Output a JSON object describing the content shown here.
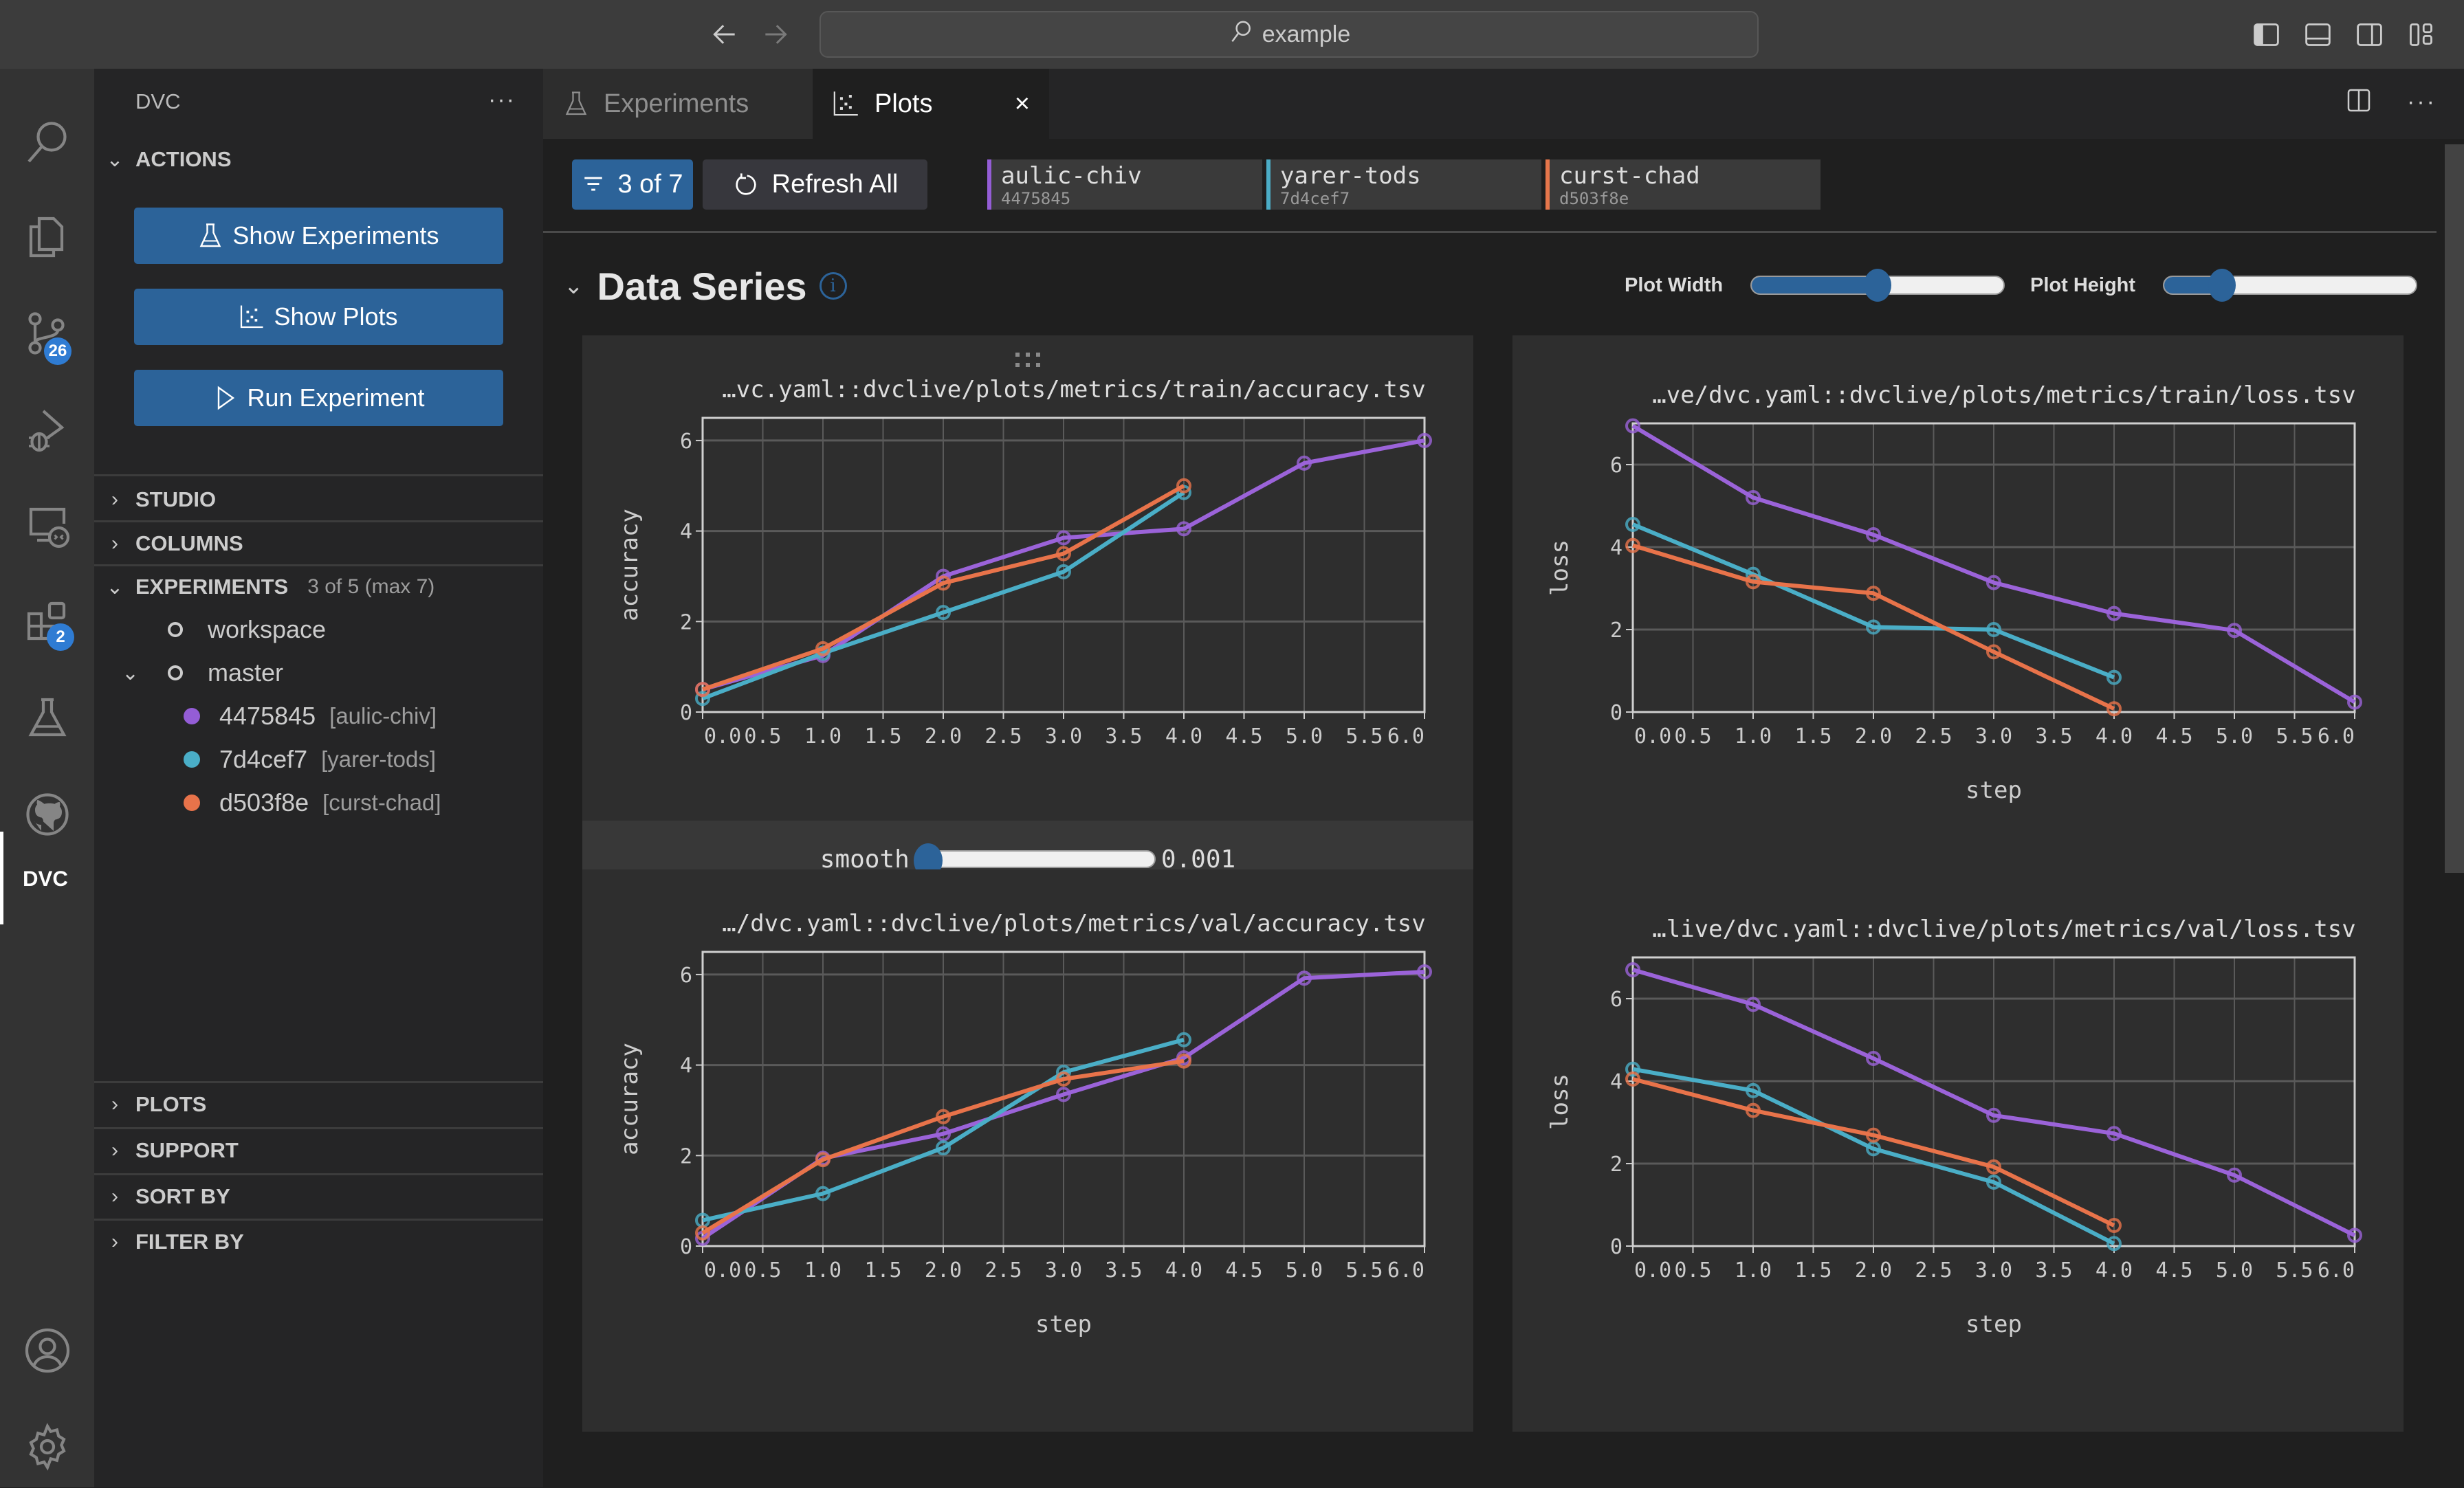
{
  "titlebar": {
    "search_text": "example",
    "back_icon": "arrow-left-icon",
    "forward_icon": "arrow-right-icon",
    "layout_icons": [
      "toggle-primary-sidebar-icon",
      "toggle-panel-icon",
      "toggle-secondary-sidebar-icon",
      "customize-layout-icon"
    ]
  },
  "activity_bar": {
    "items": [
      {
        "name": "search",
        "icon": "search-icon"
      },
      {
        "name": "explorer",
        "icon": "files-icon"
      },
      {
        "name": "source-control",
        "icon": "source-control-icon",
        "badge": "26"
      },
      {
        "name": "run-debug",
        "icon": "debug-icon"
      },
      {
        "name": "remote-explorer",
        "icon": "remote-explorer-icon"
      },
      {
        "name": "extensions",
        "icon": "extensions-icon",
        "badge": "2"
      },
      {
        "name": "testing",
        "icon": "flask-icon"
      },
      {
        "name": "github",
        "icon": "github-icon"
      },
      {
        "name": "dvc",
        "icon": "dvc-logo-icon",
        "active": true,
        "label": "DVC"
      }
    ],
    "bottom": [
      {
        "name": "accounts",
        "icon": "account-icon"
      },
      {
        "name": "manage",
        "icon": "gear-icon"
      }
    ]
  },
  "sidebar": {
    "title": "DVC",
    "more": "···",
    "actions": {
      "header": "ACTIONS",
      "buttons": [
        {
          "label": "Show Experiments",
          "icon": "flask-icon"
        },
        {
          "label": "Show Plots",
          "icon": "scatter-plot-icon"
        },
        {
          "label": "Run Experiment",
          "icon": "play-icon"
        }
      ]
    },
    "sections": {
      "studio": "STUDIO",
      "columns": "COLUMNS",
      "experiments": "EXPERIMENTS",
      "experiments_count": "3 of 5 (max 7)",
      "plots": "PLOTS",
      "support": "SUPPORT",
      "sort_by": "SORT BY",
      "filter_by": "FILTER BY"
    },
    "experiments_tree": {
      "workspace": "workspace",
      "master": "master",
      "experiments": [
        {
          "id": "4475845",
          "name": "[aulic-chiv]",
          "color": "#945dd6"
        },
        {
          "id": "7d4cef7",
          "name": "[yarer-tods]",
          "color": "#13adc7"
        },
        {
          "id": "d503f8e",
          "name": "[curst-chad]",
          "color": "#f46837"
        }
      ]
    }
  },
  "tabs": [
    {
      "label": "Experiments",
      "icon": "flask-icon",
      "active": false
    },
    {
      "label": "Plots",
      "icon": "scatter-plot-icon",
      "active": true,
      "close": "×"
    }
  ],
  "toolbar": {
    "filter_label": "3 of 7",
    "refresh_label": "Refresh All",
    "experiments": [
      {
        "name": "aulic-chiv",
        "rev": "4475845",
        "color": "#945dd6"
      },
      {
        "name": "yarer-tods",
        "rev": "7d4cef7",
        "color": "#4bacc6"
      },
      {
        "name": "curst-chad",
        "rev": "d503f8e",
        "color": "#e6764b"
      }
    ]
  },
  "section": {
    "title": "Data Series",
    "info": "i",
    "plot_width_label": "Plot Width",
    "plot_height_label": "Plot Height",
    "plot_width_value": 0.5,
    "plot_height_value": 0.23
  },
  "smooth": {
    "label": "smooth",
    "value": "0.001",
    "fraction": 0.0
  },
  "series_colors": {
    "aulic-chiv": "#9b63d9",
    "yarer-tods": "#4aaec7",
    "curst-chad": "#e8734a"
  },
  "chart_data": [
    {
      "type": "line",
      "title": "…vc.yaml::dvclive/plots/metrics/train/accuracy.tsv",
      "xlabel": "",
      "ylabel": "accuracy",
      "xlim": [
        0,
        6
      ],
      "ylim": [
        0,
        6.5
      ],
      "xticks": [
        "0.0",
        "0.5",
        "1.0",
        "1.5",
        "2.0",
        "2.5",
        "3.0",
        "3.5",
        "4.0",
        "4.5",
        "5.0",
        "5.5",
        "6.0"
      ],
      "yticks": [
        0,
        2,
        4,
        6
      ],
      "grid": true,
      "smooth_control": true,
      "series": [
        {
          "name": "aulic-chiv",
          "x": [
            0,
            1,
            2,
            3,
            4,
            5,
            6
          ],
          "y": [
            0.5,
            1.25,
            3.0,
            3.85,
            4.05,
            5.5,
            6.0
          ]
        },
        {
          "name": "yarer-tods",
          "x": [
            0,
            1,
            2,
            3,
            4
          ],
          "y": [
            0.3,
            1.3,
            2.2,
            3.1,
            4.85
          ]
        },
        {
          "name": "curst-chad",
          "x": [
            0,
            1,
            2,
            3,
            4
          ],
          "y": [
            0.5,
            1.4,
            2.85,
            3.5,
            5.0
          ]
        }
      ]
    },
    {
      "type": "line",
      "title": "…ve/dvc.yaml::dvclive/plots/metrics/train/loss.tsv",
      "xlabel": "step",
      "ylabel": "loss",
      "xlim": [
        0,
        6
      ],
      "ylim": [
        0,
        7
      ],
      "xticks": [
        "0.0",
        "0.5",
        "1.0",
        "1.5",
        "2.0",
        "2.5",
        "3.0",
        "3.5",
        "4.0",
        "4.5",
        "5.0",
        "5.5",
        "6.0"
      ],
      "yticks": [
        0,
        2,
        4,
        6
      ],
      "grid": true,
      "series": [
        {
          "name": "aulic-chiv",
          "x": [
            0,
            1,
            2,
            3,
            4,
            5,
            6
          ],
          "y": [
            6.94,
            5.2,
            4.3,
            3.14,
            2.39,
            1.98,
            0.24
          ]
        },
        {
          "name": "yarer-tods",
          "x": [
            0,
            1,
            2,
            3,
            4
          ],
          "y": [
            4.55,
            3.34,
            2.06,
            2.0,
            0.84
          ]
        },
        {
          "name": "curst-chad",
          "x": [
            0,
            1,
            2,
            3,
            4
          ],
          "y": [
            4.04,
            3.16,
            2.88,
            1.46,
            0.08
          ]
        }
      ]
    },
    {
      "type": "line",
      "title": "…/dvc.yaml::dvclive/plots/metrics/val/accuracy.tsv",
      "xlabel": "step",
      "ylabel": "accuracy",
      "xlim": [
        0,
        6
      ],
      "ylim": [
        0,
        6.5
      ],
      "xticks": [
        "0.0",
        "0.5",
        "1.0",
        "1.5",
        "2.0",
        "2.5",
        "3.0",
        "3.5",
        "4.0",
        "4.5",
        "5.0",
        "5.5",
        "6.0"
      ],
      "yticks": [
        0,
        2,
        4,
        6
      ],
      "grid": true,
      "series": [
        {
          "name": "aulic-chiv",
          "x": [
            0,
            1,
            2,
            3,
            4,
            5,
            6
          ],
          "y": [
            0.17,
            1.94,
            2.48,
            3.35,
            4.16,
            5.92,
            6.06
          ]
        },
        {
          "name": "yarer-tods",
          "x": [
            0,
            1,
            2,
            3,
            4
          ],
          "y": [
            0.57,
            1.16,
            2.17,
            3.84,
            4.56
          ]
        },
        {
          "name": "curst-chad",
          "x": [
            0,
            1,
            2,
            3,
            4
          ],
          "y": [
            0.29,
            1.91,
            2.86,
            3.69,
            4.09
          ]
        }
      ]
    },
    {
      "type": "line",
      "title": "…live/dvc.yaml::dvclive/plots/metrics/val/loss.tsv",
      "xlabel": "step",
      "ylabel": "loss",
      "xlim": [
        0,
        6
      ],
      "ylim": [
        0,
        7
      ],
      "xticks": [
        "0.0",
        "0.5",
        "1.0",
        "1.5",
        "2.0",
        "2.5",
        "3.0",
        "3.5",
        "4.0",
        "4.5",
        "5.0",
        "5.5",
        "6.0"
      ],
      "yticks": [
        0,
        2,
        4,
        6
      ],
      "grid": true,
      "series": [
        {
          "name": "aulic-chiv",
          "x": [
            0,
            1,
            2,
            3,
            4,
            5,
            6
          ],
          "y": [
            6.7,
            5.86,
            4.55,
            3.17,
            2.73,
            1.72,
            0.26
          ]
        },
        {
          "name": "yarer-tods",
          "x": [
            0,
            1,
            2,
            3,
            4
          ],
          "y": [
            4.29,
            3.77,
            2.36,
            1.55,
            0.06
          ]
        },
        {
          "name": "curst-chad",
          "x": [
            0,
            1,
            2,
            3,
            4
          ],
          "y": [
            4.05,
            3.29,
            2.69,
            1.92,
            0.5
          ]
        }
      ]
    }
  ]
}
